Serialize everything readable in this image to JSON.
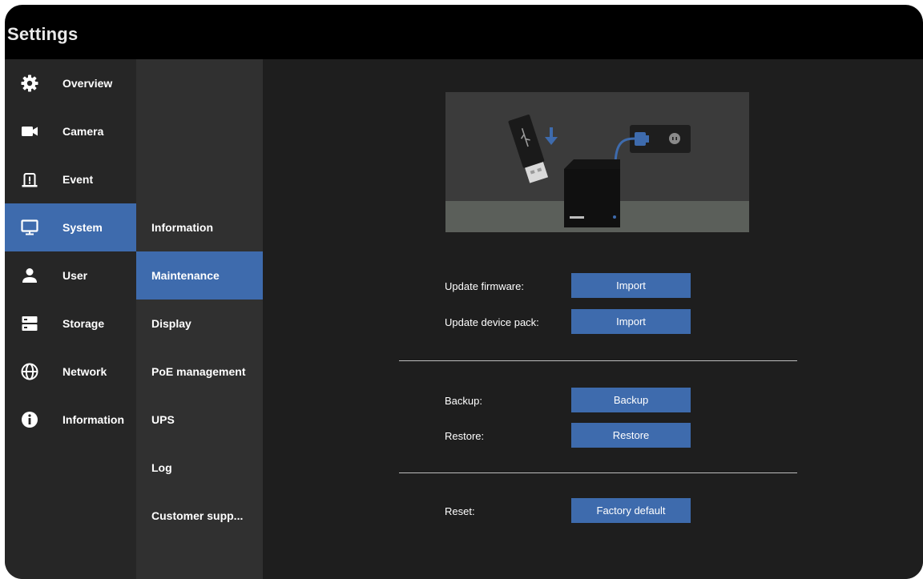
{
  "window": {
    "title": "Settings"
  },
  "sidebar": {
    "items": [
      {
        "label": "Overview",
        "icon": "gear-icon"
      },
      {
        "label": "Camera",
        "icon": "video-camera-icon"
      },
      {
        "label": "Event",
        "icon": "alarm-icon"
      },
      {
        "label": "System",
        "icon": "monitor-icon",
        "active": true
      },
      {
        "label": "User",
        "icon": "user-icon"
      },
      {
        "label": "Storage",
        "icon": "storage-icon"
      },
      {
        "label": "Network",
        "icon": "globe-icon"
      },
      {
        "label": "Information",
        "icon": "info-icon"
      }
    ]
  },
  "submenu": {
    "items": [
      {
        "label": "Information"
      },
      {
        "label": "Maintenance",
        "active": true
      },
      {
        "label": "Display"
      },
      {
        "label": "PoE management"
      },
      {
        "label": "UPS"
      },
      {
        "label": "Log"
      },
      {
        "label": "Customer supp..."
      }
    ]
  },
  "maintenance": {
    "update_firmware": {
      "label": "Update firmware:",
      "button": "Import"
    },
    "update_device_pack": {
      "label": "Update device pack:",
      "button": "Import"
    },
    "backup": {
      "label": "Backup:",
      "button": "Backup"
    },
    "restore": {
      "label": "Restore:",
      "button": "Restore"
    },
    "reset": {
      "label": "Reset:",
      "button": "Factory default"
    }
  },
  "colors": {
    "accent": "#3e6bad",
    "sidebar_bg": "#262626",
    "submenu_bg": "#303030",
    "content_bg": "#1e1e1e",
    "titlebar_bg": "#000000"
  }
}
